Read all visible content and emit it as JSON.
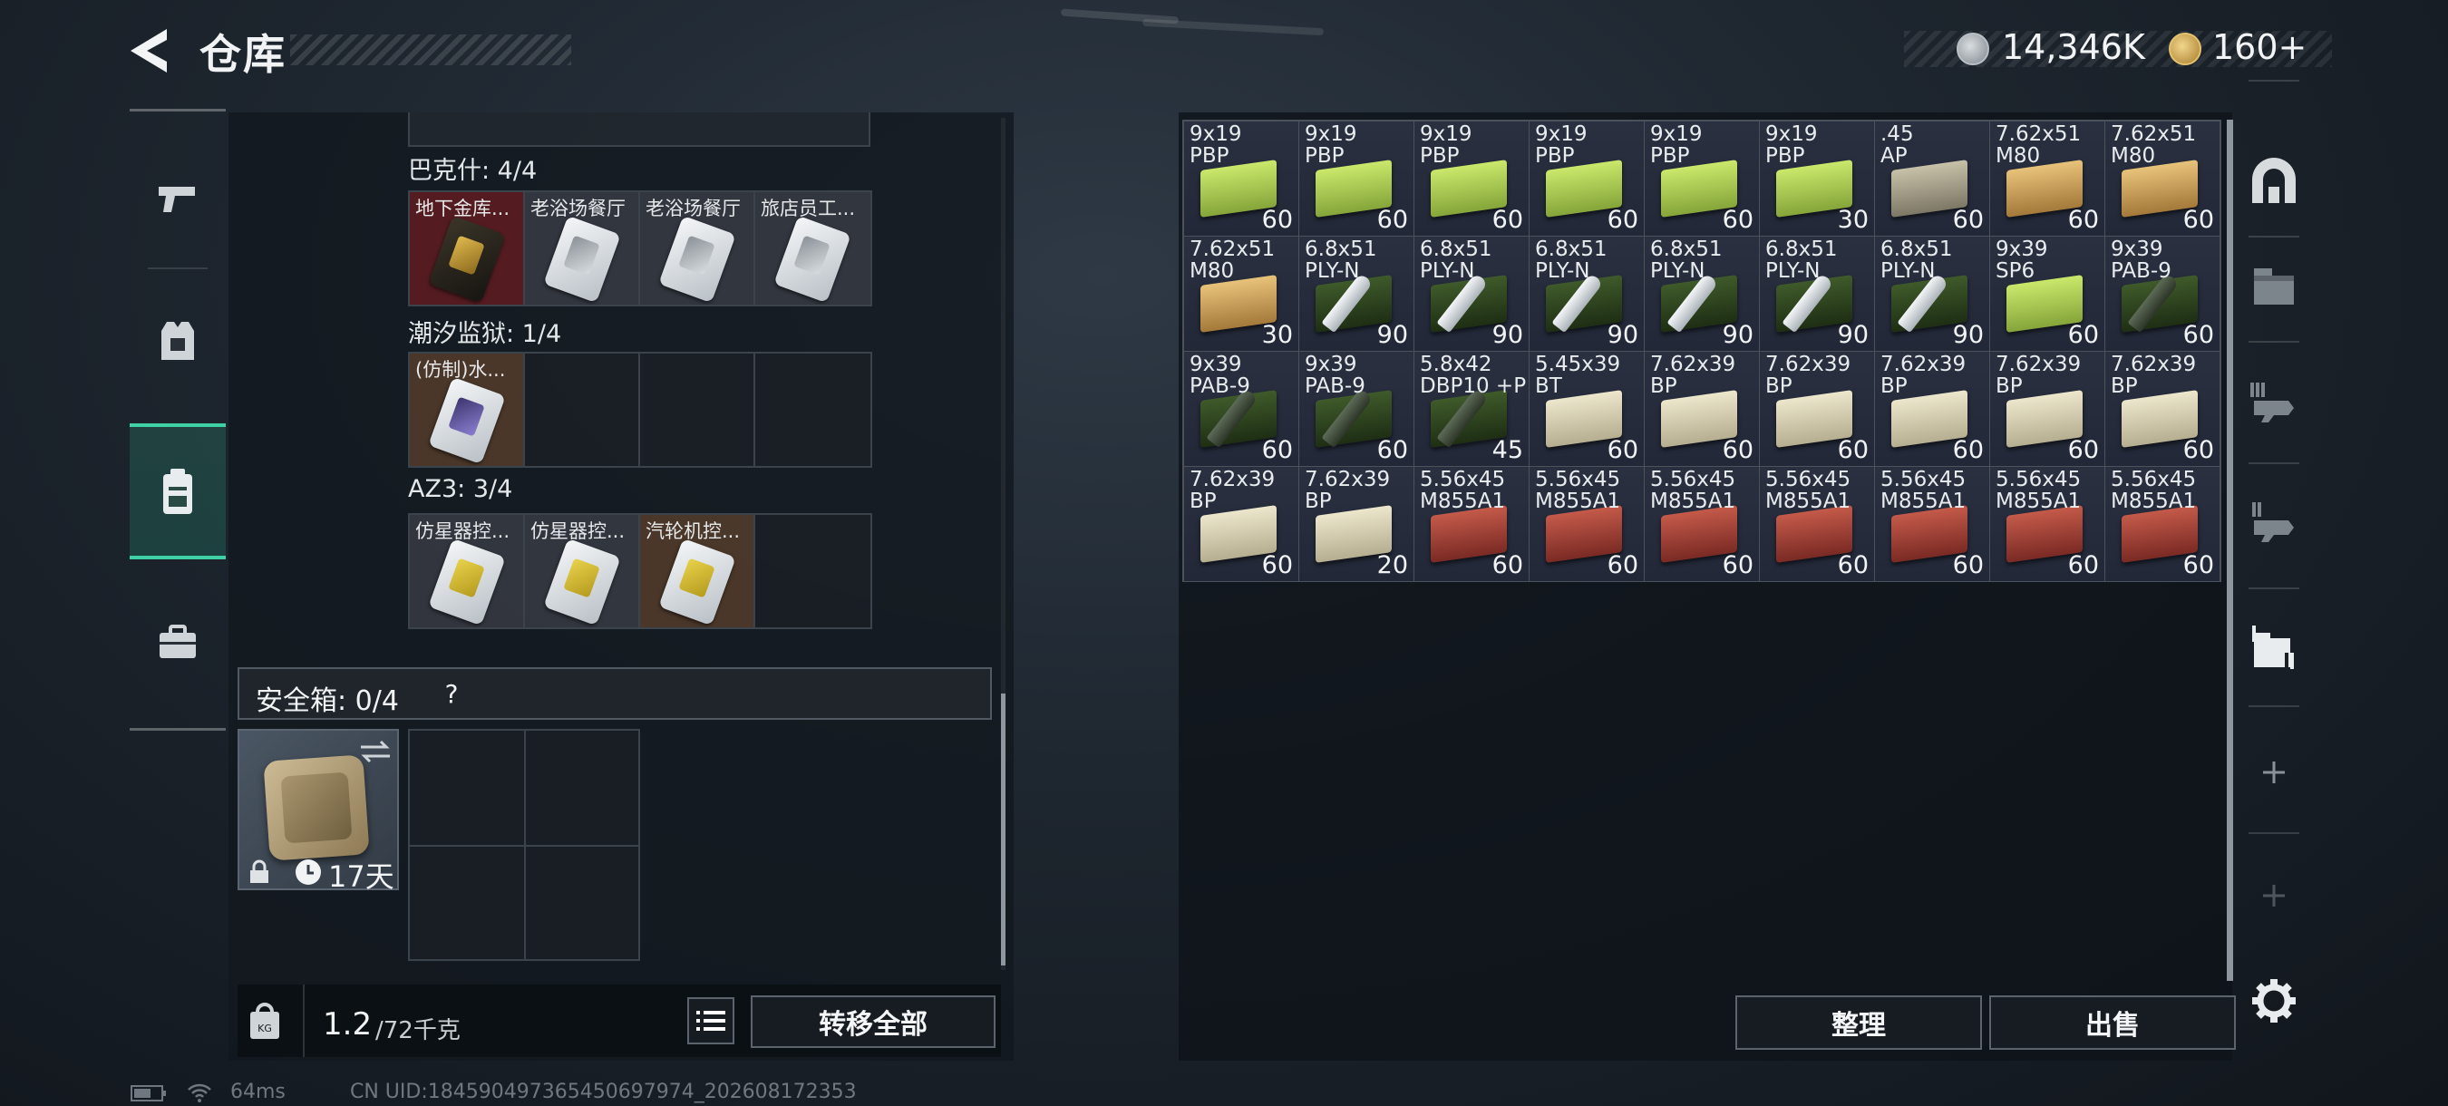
{
  "header": {
    "title": "仓库",
    "currency1": "14,346K",
    "currency2": "160+"
  },
  "left_nav": [
    {
      "name": "weapons-icon"
    },
    {
      "name": "gear-icon"
    },
    {
      "name": "backpack-icon",
      "active": true
    },
    {
      "name": "toolbox-icon"
    }
  ],
  "groups": [
    {
      "label": "巴克什: 4/4",
      "items": [
        {
          "name": "地下金库...",
          "bg": "red",
          "card": "gold"
        },
        {
          "name": "老浴场餐厅",
          "bg": "gray",
          "card": "silver"
        },
        {
          "name": "老浴场餐厅",
          "bg": "gray",
          "card": "silver"
        },
        {
          "name": "旅店员工...",
          "bg": "gray",
          "card": "silver"
        }
      ]
    },
    {
      "label": "潮汐监狱: 1/4",
      "items": [
        {
          "name": "(仿制)水...",
          "bg": "brown",
          "card": "purple"
        }
      ]
    },
    {
      "label": "AZ3: 3/4",
      "items": [
        {
          "name": "仿星器控...",
          "bg": "gray",
          "card": "yellow"
        },
        {
          "name": "仿星器控...",
          "bg": "gray",
          "card": "yellow"
        },
        {
          "name": "汽轮机控...",
          "bg": "brown",
          "card": "yellow"
        }
      ]
    }
  ],
  "safe_box": {
    "label": "安全箱: 0/4",
    "help": "?",
    "timer": "17天"
  },
  "weight": {
    "current": "1.2",
    "max": "/72千克"
  },
  "buttons": {
    "transfer_all": "转移全部",
    "organize": "整理",
    "sell": "出售"
  },
  "ammo": [
    {
      "l1": "9x19",
      "l2": "PBP",
      "c": "60",
      "b": "green"
    },
    {
      "l1": "9x19",
      "l2": "PBP",
      "c": "60",
      "b": "green"
    },
    {
      "l1": "9x19",
      "l2": "PBP",
      "c": "60",
      "b": "green"
    },
    {
      "l1": "9x19",
      "l2": "PBP",
      "c": "60",
      "b": "green"
    },
    {
      "l1": "9x19",
      "l2": "PBP",
      "c": "60",
      "b": "green"
    },
    {
      "l1": "9x19",
      "l2": "PBP",
      "c": "30",
      "b": "green"
    },
    {
      "l1": ".45",
      "l2": "AP",
      "c": "60",
      "b": "gray"
    },
    {
      "l1": "7.62x51",
      "l2": "M80",
      "c": "60",
      "b": "tan"
    },
    {
      "l1": "7.62x51",
      "l2": "M80",
      "c": "60",
      "b": "tan"
    },
    {
      "l1": "7.62x51",
      "l2": "M80",
      "c": "30",
      "b": "tan"
    },
    {
      "l1": "6.8x51",
      "l2": "PLY-N",
      "c": "90",
      "b": "dkgreen",
      "bullet": "light"
    },
    {
      "l1": "6.8x51",
      "l2": "PLY-N",
      "c": "90",
      "b": "dkgreen",
      "bullet": "light"
    },
    {
      "l1": "6.8x51",
      "l2": "PLY-N",
      "c": "90",
      "b": "dkgreen",
      "bullet": "light"
    },
    {
      "l1": "6.8x51",
      "l2": "PLY-N",
      "c": "90",
      "b": "dkgreen",
      "bullet": "light"
    },
    {
      "l1": "6.8x51",
      "l2": "PLY-N",
      "c": "90",
      "b": "dkgreen",
      "bullet": "light"
    },
    {
      "l1": "6.8x51",
      "l2": "PLY-N",
      "c": "90",
      "b": "dkgreen",
      "bullet": "light"
    },
    {
      "l1": "9x39",
      "l2": "SP6",
      "c": "60",
      "b": "green"
    },
    {
      "l1": "9x39",
      "l2": "PAB-9",
      "c": "60",
      "b": "dkgreen",
      "bullet": "dark"
    },
    {
      "l1": "9x39",
      "l2": "PAB-9",
      "c": "60",
      "b": "dkgreen",
      "bullet": "dark"
    },
    {
      "l1": "9x39",
      "l2": "PAB-9",
      "c": "60",
      "b": "dkgreen",
      "bullet": "dark"
    },
    {
      "l1": "5.8x42",
      "l2": "DBP10 +P",
      "c": "45",
      "b": "dkgreen",
      "bullet": "dark"
    },
    {
      "l1": "5.45x39",
      "l2": "BT",
      "c": "60",
      "b": "cream"
    },
    {
      "l1": "7.62x39",
      "l2": "BP",
      "c": "60",
      "b": "cream"
    },
    {
      "l1": "7.62x39",
      "l2": "BP",
      "c": "60",
      "b": "cream"
    },
    {
      "l1": "7.62x39",
      "l2": "BP",
      "c": "60",
      "b": "cream"
    },
    {
      "l1": "7.62x39",
      "l2": "BP",
      "c": "60",
      "b": "cream"
    },
    {
      "l1": "7.62x39",
      "l2": "BP",
      "c": "60",
      "b": "cream"
    },
    {
      "l1": "7.62x39",
      "l2": "BP",
      "c": "60",
      "b": "cream"
    },
    {
      "l1": "7.62x39",
      "l2": "BP",
      "c": "20",
      "b": "cream"
    },
    {
      "l1": "5.56x45",
      "l2": "M855A1",
      "c": "60",
      "b": "red"
    },
    {
      "l1": "5.56x45",
      "l2": "M855A1",
      "c": "60",
      "b": "red"
    },
    {
      "l1": "5.56x45",
      "l2": "M855A1",
      "c": "60",
      "b": "red"
    },
    {
      "l1": "5.56x45",
      "l2": "M855A1",
      "c": "60",
      "b": "red"
    },
    {
      "l1": "5.56x45",
      "l2": "M855A1",
      "c": "60",
      "b": "red"
    },
    {
      "l1": "5.56x45",
      "l2": "M855A1",
      "c": "60",
      "b": "red"
    },
    {
      "l1": "5.56x45",
      "l2": "M855A1",
      "c": "60",
      "b": "red"
    }
  ],
  "status": {
    "ping": "64ms",
    "uid": "CN UID:1845904973654506979​74_202608172353"
  }
}
